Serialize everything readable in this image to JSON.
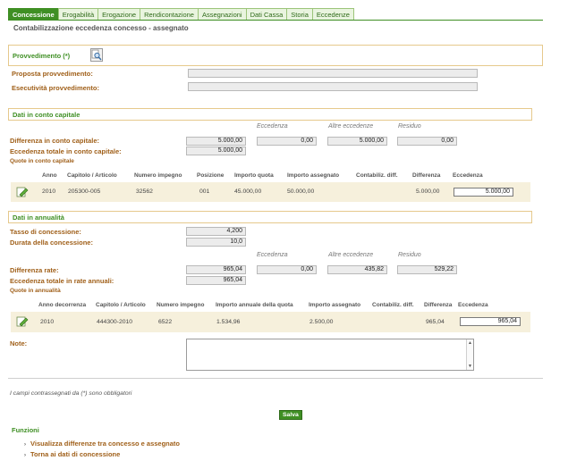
{
  "tabs": [
    "Concessione",
    "Erogabilità",
    "Erogazione",
    "Rendicontazione",
    "Assegnazioni",
    "Dati Cassa",
    "Storia",
    "Eccedenze"
  ],
  "page_title": "Contabilizzazione eccedenza concesso - assegnato",
  "provvedimento": {
    "title": "Provvedimento (*)",
    "proposta_label": "Proposta provvedimento:",
    "proposta_value": "",
    "esecutivita_label": "Esecutività provvedimento:",
    "esecutivita_value": ""
  },
  "capitale": {
    "title": "Dati in conto capitale",
    "col_eccedenza": "Eccedenza",
    "col_altre": "Altre eccedenze",
    "col_residuo": "Residuo",
    "differenza_label": "Differenza in conto capitale:",
    "differenza_value": "5.000,00",
    "eccedenza_value": "0,00",
    "altre_value": "5.000,00",
    "residuo_value": "0,00",
    "eccedenza_totale_label": "Eccedenza totale in conto capitale:",
    "eccedenza_totale_value": "5.000,00",
    "quote_label": "Quote in conto capitale",
    "headers": [
      "Anno",
      "Capitolo / Articolo",
      "Numero impegno",
      "Posizione",
      "Importo quota",
      "Importo assegnato",
      "Contabiliz. diff.",
      "Differenza",
      "Eccedenza"
    ],
    "row": {
      "anno": "2010",
      "capitolo": "205300-005",
      "impegno": "32562",
      "posizione": "001",
      "importo_quota": "45.000,00",
      "importo_assegnato": "50.000,00",
      "contabiliz": "",
      "differenza": "5.000,00",
      "eccedenza": "5.000,00"
    }
  },
  "annualita": {
    "title": "Dati in annualità",
    "tasso_label": "Tasso di concessione:",
    "tasso_value": "4,200",
    "durata_label": "Durata della concessione:",
    "durata_value": "10,0",
    "col_eccedenza": "Eccedenza",
    "col_altre": "Altre eccedenze",
    "col_residuo": "Residuo",
    "differenza_label": "Differenza rate:",
    "differenza_value": "965,04",
    "eccedenza_value": "0,00",
    "altre_value": "435,82",
    "residuo_value": "529,22",
    "eccedenza_totale_label": "Eccedenza totale in rate annuali:",
    "eccedenza_totale_value": "965,04",
    "quote_label": "Quote in annualità",
    "headers": [
      "Anno decorrenza",
      "Capitolo / Articolo",
      "Numero impegno",
      "Importo annuale della quota",
      "Importo assegnato",
      "Contabiliz. diff.",
      "Differenza",
      "Eccedenza"
    ],
    "row": {
      "anno": "2010",
      "capitolo": "444300-2010",
      "impegno": "6522",
      "importo_annuale": "1.534,96",
      "importo_assegnato": "2.500,00",
      "contabiliz": "",
      "differenza": "965,04",
      "eccedenza": "965,04"
    }
  },
  "note": {
    "label": "Note:",
    "value": ""
  },
  "required_note": "I campi contrassegnati da (*) sono obbligatori",
  "save_label": "Salva",
  "funzioni": {
    "title": "Funzioni",
    "links": [
      "Visualizza differenze tra concesso e assegnato",
      "Torna ai dati di concessione"
    ]
  },
  "colors": {
    "accent": "#3f8f24",
    "label": "#a0601a",
    "section_border": "#e6c98c",
    "row_bg": "#f6f0dc"
  },
  "icons": {
    "lookup": "search-document-icon",
    "row_action": "edit-pencil-icon"
  }
}
